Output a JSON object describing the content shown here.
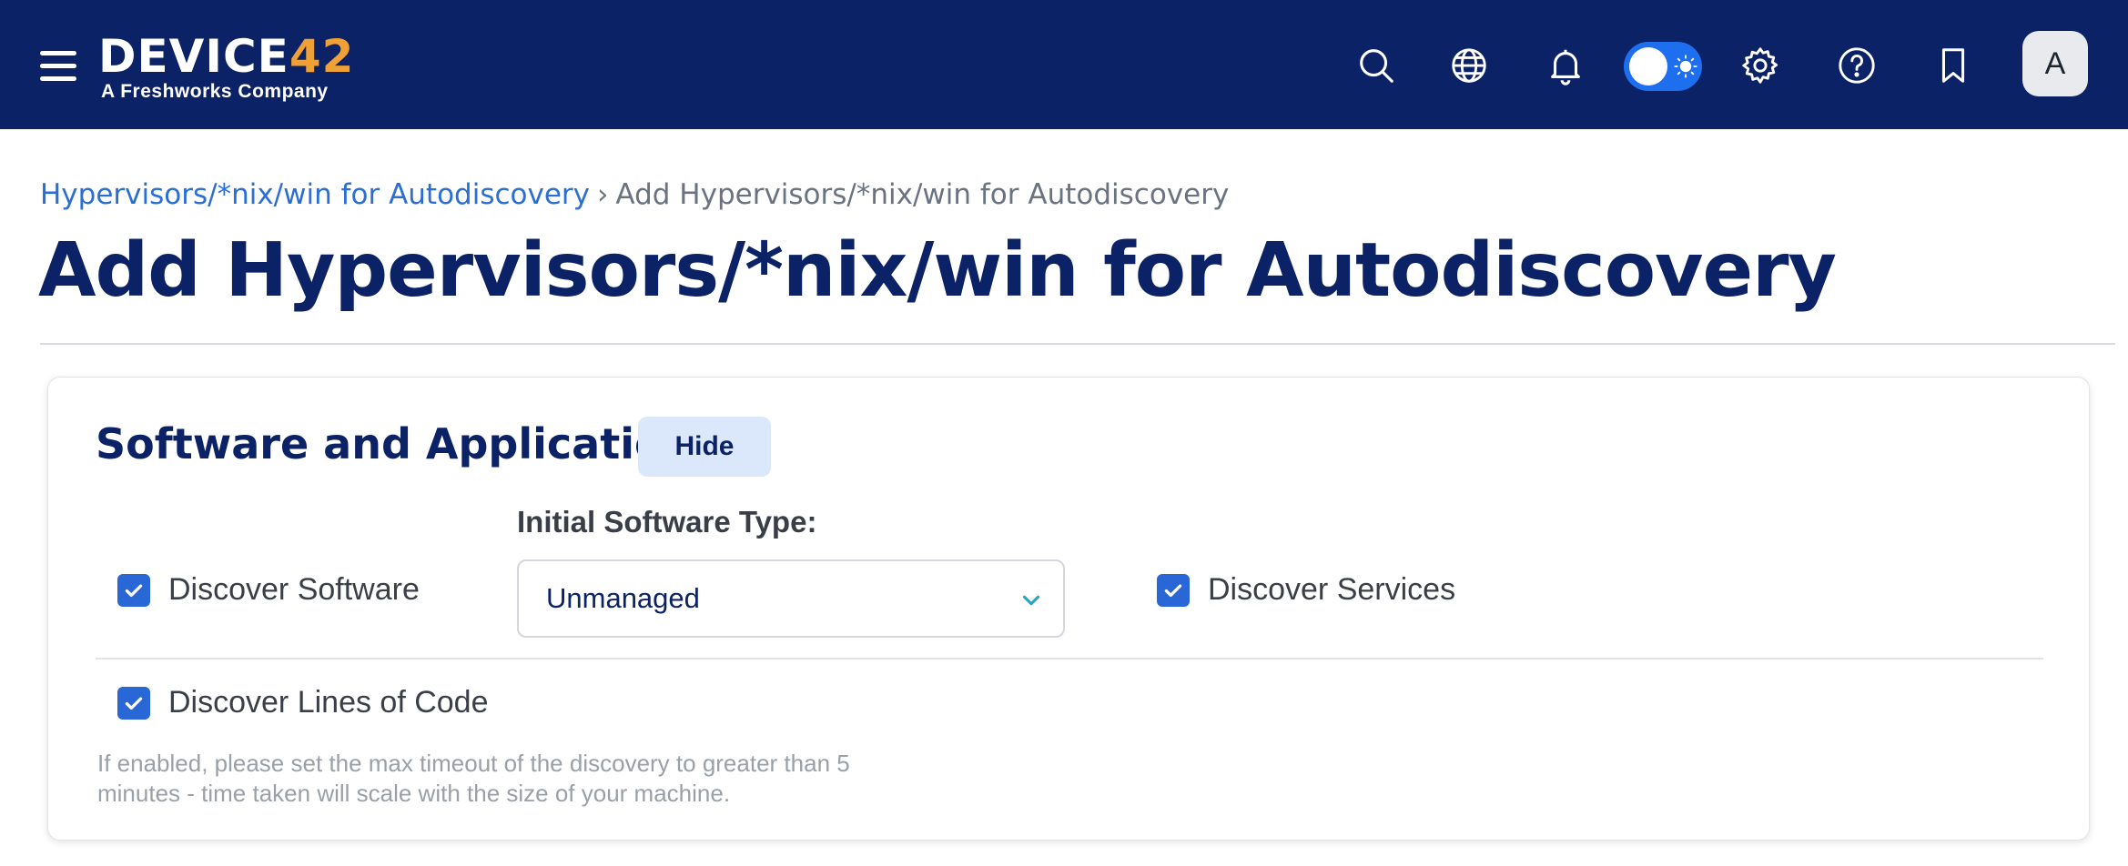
{
  "brand": {
    "logo_text_main": "DEVICE",
    "logo_text_accent": "42",
    "logo_tagline": "A Freshworks Company",
    "bar_color": "#0c2266",
    "accent_color": "#f0a135"
  },
  "topbar": {
    "icons": [
      "menu-icon",
      "search-icon",
      "globe-icon",
      "bell-icon",
      "theme-toggle",
      "gear-icon",
      "help-icon",
      "bookmark-icon"
    ],
    "theme_toggle_on": true,
    "avatar_initial": "A"
  },
  "breadcrumb": {
    "parent": "Hypervisors/*nix/win for Autodiscovery",
    "separator": "›",
    "current": "Add Hypervisors/*nix/win for Autodiscovery"
  },
  "page": {
    "title": "Add Hypervisors/*nix/win for Autodiscovery"
  },
  "section": {
    "title": "Software and Applications",
    "hide_label": "Hide",
    "discover_software": {
      "label": "Discover Software",
      "checked": true
    },
    "initial_software_type": {
      "label": "Initial Software Type:",
      "value": "Unmanaged"
    },
    "discover_services": {
      "label": "Discover Services",
      "checked": true
    },
    "discover_loc": {
      "label": "Discover Lines of Code",
      "checked": true
    },
    "help_text": "If enabled, please set the max timeout of the discovery to greater than 5 minutes - time taken will scale with the size of your machine."
  }
}
